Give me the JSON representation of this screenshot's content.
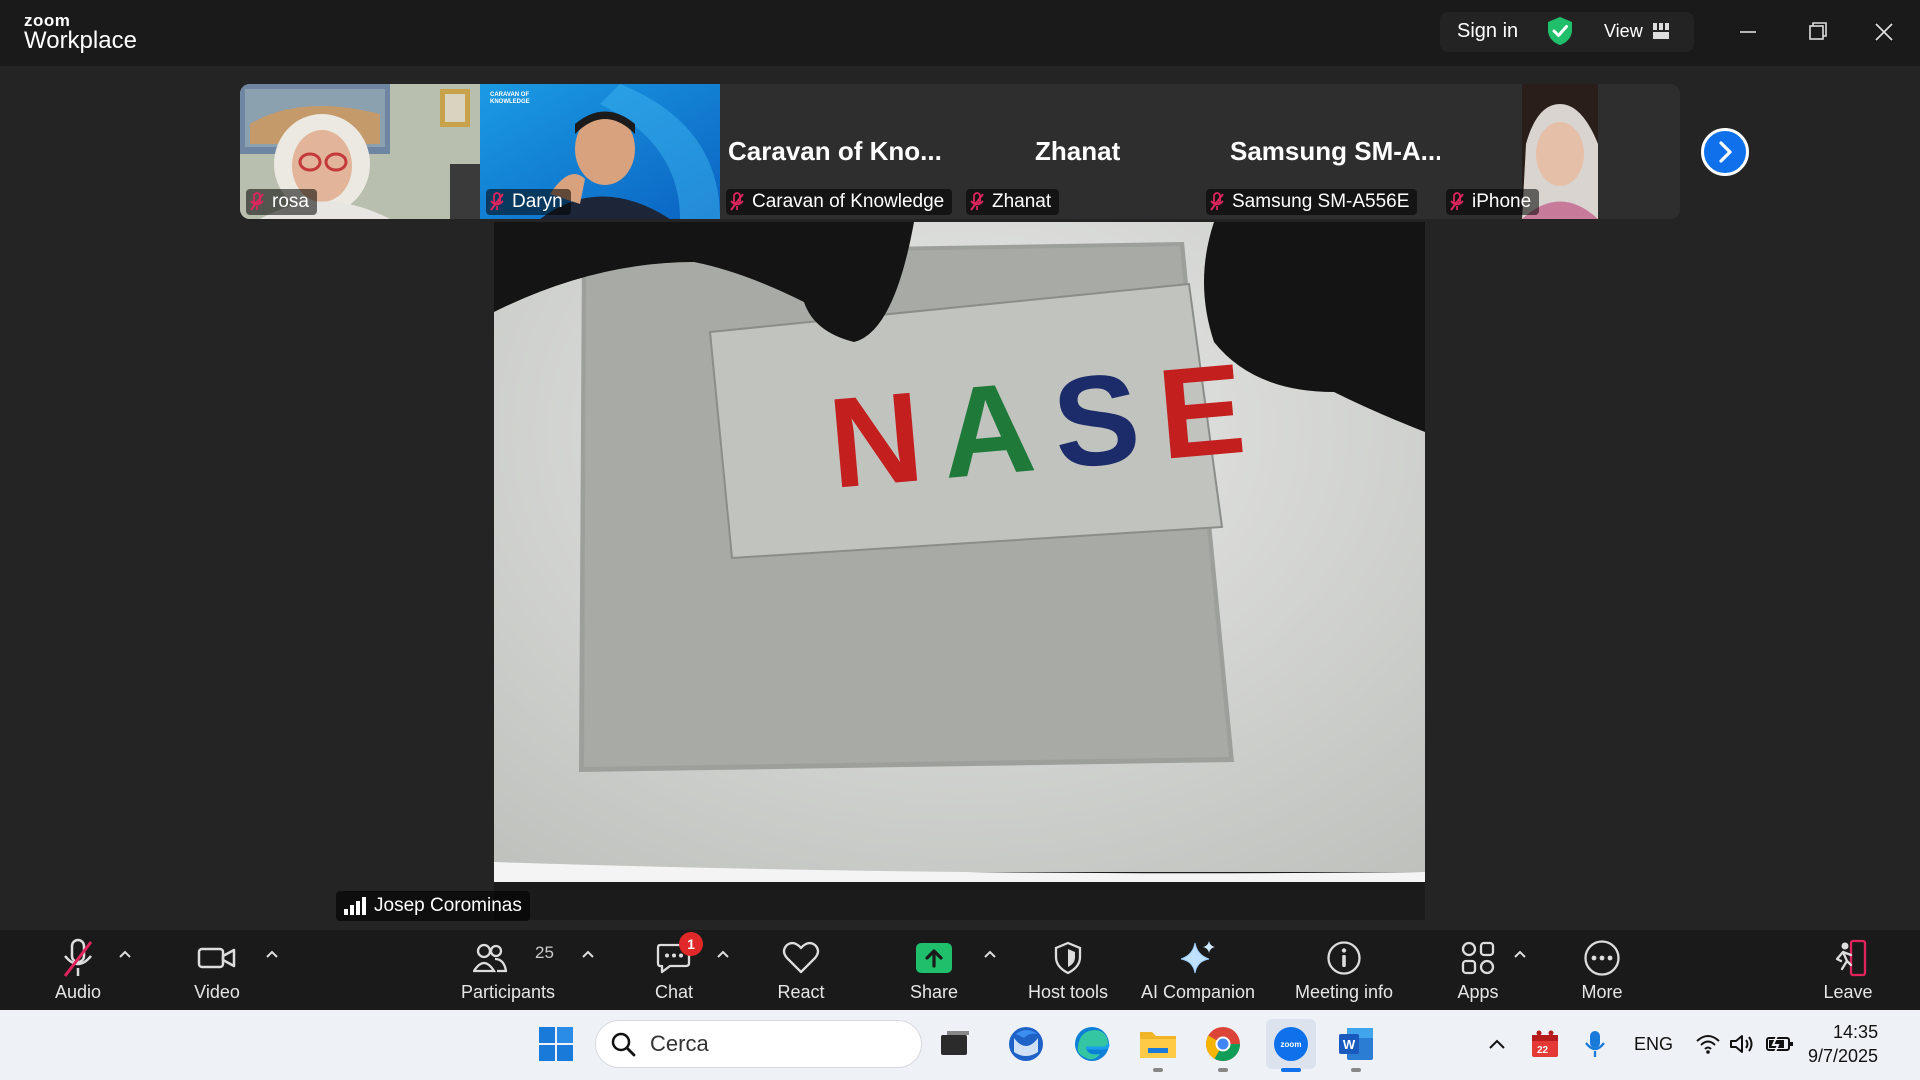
{
  "titlebar": {
    "brand_small": "zoom",
    "brand_large": "Workplace",
    "signin": "Sign in",
    "view": "View"
  },
  "filmstrip": {
    "participants": [
      {
        "name": "rosa",
        "muted": true,
        "video": true
      },
      {
        "name": "Daryn",
        "muted": true,
        "video": true
      },
      {
        "name": "Caravan of Knowledge",
        "display_name": "Caravan of Kno...",
        "muted": true,
        "video": false
      },
      {
        "name": "Zhanat",
        "display_name": "Zhanat",
        "muted": true,
        "video": false
      },
      {
        "name": "Samsung SM-A556E",
        "display_name": "Samsung SM-A...",
        "muted": true,
        "video": false
      },
      {
        "name": "iPhone",
        "muted": true,
        "video": true
      }
    ],
    "logo_text_1": "CARAVAN OF",
    "logo_text_2": "KNOWLEDGE"
  },
  "main_video": {
    "speaker": "Josep Corominas",
    "card_text": "NASE",
    "card_letter_colors": [
      "#c41f1f",
      "#1f7a3a",
      "#1c2c6a",
      "#c41f1f"
    ]
  },
  "toolbar": {
    "audio": "Audio",
    "video": "Video",
    "participants": "Participants",
    "participants_count": "25",
    "chat": "Chat",
    "chat_badge": "1",
    "react": "React",
    "share": "Share",
    "host_tools": "Host tools",
    "ai_companion": "AI Companion",
    "meeting_info": "Meeting info",
    "apps": "Apps",
    "more": "More",
    "leave": "Leave"
  },
  "taskbar": {
    "search_placeholder": "Cerca",
    "calendar_badge": "22",
    "language": "ENG",
    "time": "14:35",
    "date": "9/7/2025"
  },
  "colors": {
    "accent": "#0e71eb",
    "share_green": "#1fbf6b",
    "mute_red": "#e0245e",
    "badge_red": "#e02828"
  }
}
